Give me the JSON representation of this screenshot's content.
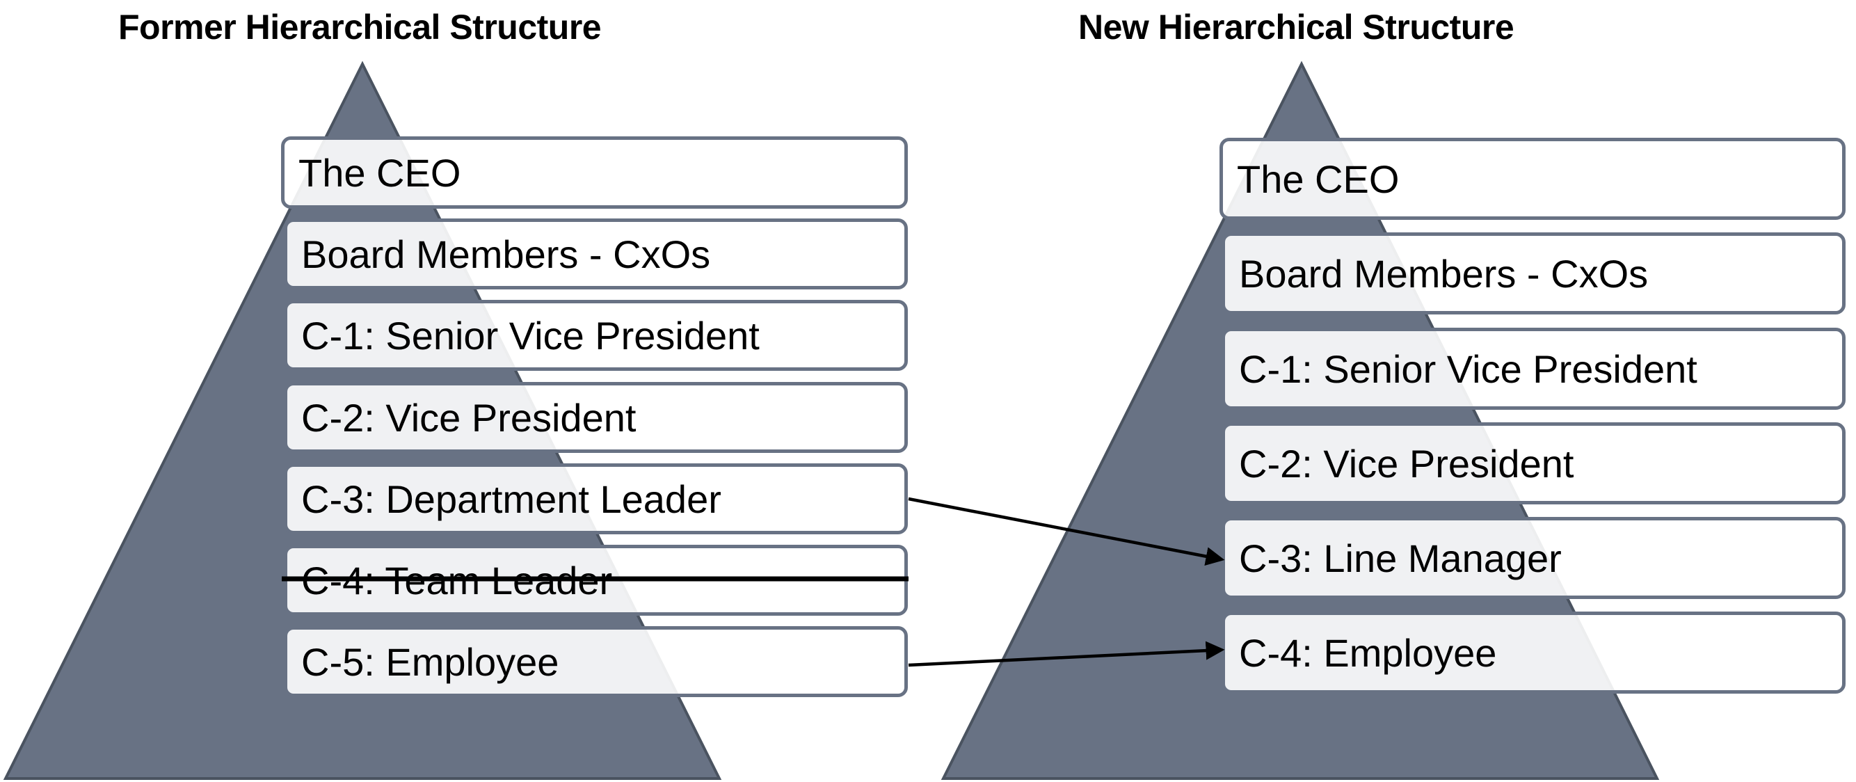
{
  "diagram": {
    "left": {
      "title": "Former Hierarchical Structure",
      "levels": [
        {
          "label": "The CEO",
          "removed": false
        },
        {
          "label": "Board Members - CxOs",
          "removed": false
        },
        {
          "label": "C-1: Senior Vice President",
          "removed": false
        },
        {
          "label": "C-2: Vice President",
          "removed": false
        },
        {
          "label": "C-3: Department Leader",
          "removed": false
        },
        {
          "label": "C-4: Team Leader",
          "removed": true
        },
        {
          "label": "C-5: Employee",
          "removed": false
        }
      ]
    },
    "right": {
      "title": "New Hierarchical Structure",
      "levels": [
        {
          "label": "The CEO"
        },
        {
          "label": "Board Members - CxOs"
        },
        {
          "label": "C-1: Senior Vice President"
        },
        {
          "label": "C-2: Vice President"
        },
        {
          "label": "C-3: Line Manager"
        },
        {
          "label": "C-4: Employee"
        }
      ]
    },
    "connections": [
      {
        "from": "C-3: Department Leader",
        "to": "C-3: Line Manager"
      },
      {
        "from": "C-5: Employee",
        "to": "C-4: Employee"
      }
    ],
    "colors": {
      "pyramid": "#687284",
      "pyramid_edge": "#4a5360",
      "box_border": "#687284",
      "arrow": "#000000"
    }
  }
}
